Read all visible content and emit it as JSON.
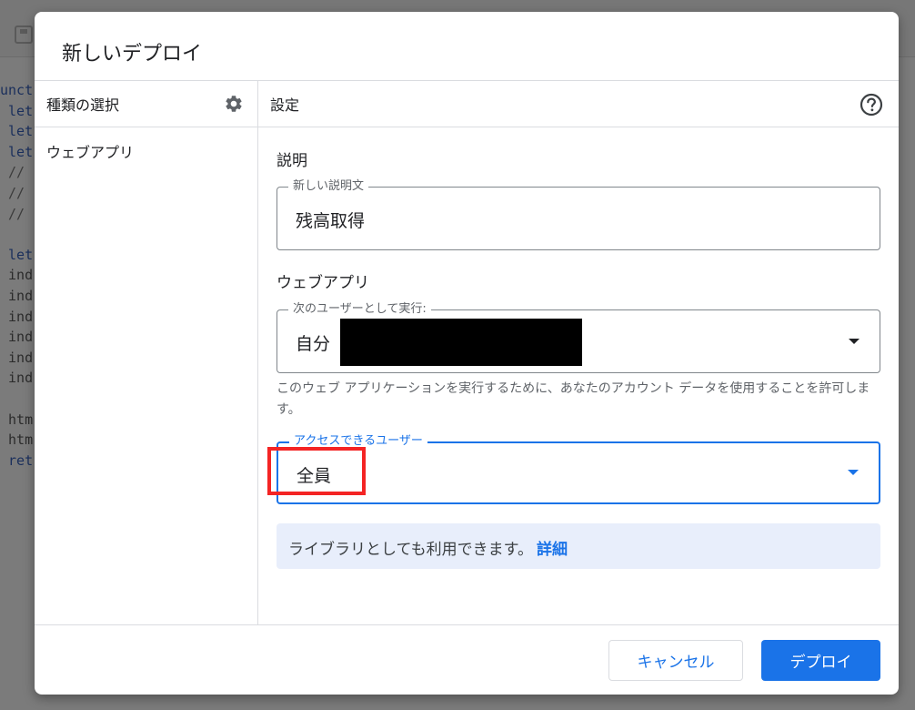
{
  "background_editor": {
    "code_lines": [
      {
        "text": "unct",
        "style": "kw"
      },
      {
        "text": " let",
        "style": "kw"
      },
      {
        "text": " let",
        "style": "kw"
      },
      {
        "text": " let",
        "style": "kw"
      },
      {
        "text": " // ",
        "style": "cm"
      },
      {
        "text": " //",
        "style": "cm"
      },
      {
        "text": " //",
        "style": "cm"
      },
      {
        "text": "",
        "style": ""
      },
      {
        "text": " let",
        "style": "kw"
      },
      {
        "text": " ind",
        "style": ""
      },
      {
        "text": " ind",
        "style": ""
      },
      {
        "text": " ind",
        "style": ""
      },
      {
        "text": " ind",
        "style": ""
      },
      {
        "text": " ind",
        "style": ""
      },
      {
        "text": " ind",
        "style": ""
      },
      {
        "text": "",
        "style": ""
      },
      {
        "text": " htm",
        "style": ""
      },
      {
        "text": " htm",
        "style": ""
      },
      {
        "text": " ret",
        "style": "kw"
      }
    ]
  },
  "dialog": {
    "title": "新しいデプロイ",
    "left_panel": {
      "header": "種類の選択",
      "header_icon": "gear-icon",
      "items": [
        "ウェブアプリ"
      ]
    },
    "right_panel": {
      "header": "設定",
      "header_icon": "help-circle-icon",
      "description_section": {
        "label": "説明",
        "field_legend": "新しい説明文",
        "field_value": "残高取得"
      },
      "webapp_section": {
        "label": "ウェブアプリ",
        "execute_as": {
          "legend": "次のユーザーとして実行:",
          "value": "自分",
          "help_text": "このウェブ アプリケーションを実行するために、あなたのアカウント データを使用することを許可します。"
        },
        "access": {
          "legend": "アクセスできるユーザー",
          "value": "全員"
        }
      },
      "info_banner": {
        "text": "ライブラリとしても利用できます。",
        "link": "詳細"
      }
    },
    "buttons": {
      "cancel": "キャンセル",
      "deploy": "デプロイ"
    }
  },
  "colors": {
    "accent": "#1a73e8",
    "highlight_box": "#f42424",
    "info_banner_bg": "#e8eefb",
    "redaction": "#000000"
  }
}
